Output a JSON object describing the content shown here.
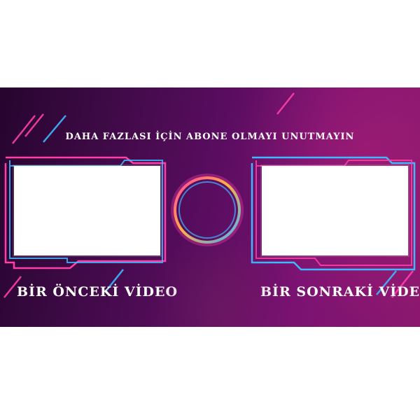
{
  "banner": {
    "headline": "DAHA FAZLASI İÇİN ABONE OLMAYI UNUTMAYIN",
    "previous_video_label": "BİR ÖNCEKİ VİDEO",
    "next_video_label": "BİR SONRAKİ VİDEO"
  },
  "colors": {
    "neon_pink": "#ff3fa8",
    "neon_blue": "#3fb8ff",
    "neon_orange": "#ffb13f",
    "background_dark": "#26052e",
    "background_magenta": "#8c186e"
  },
  "icons": {
    "center": "neon-ring-icon"
  }
}
